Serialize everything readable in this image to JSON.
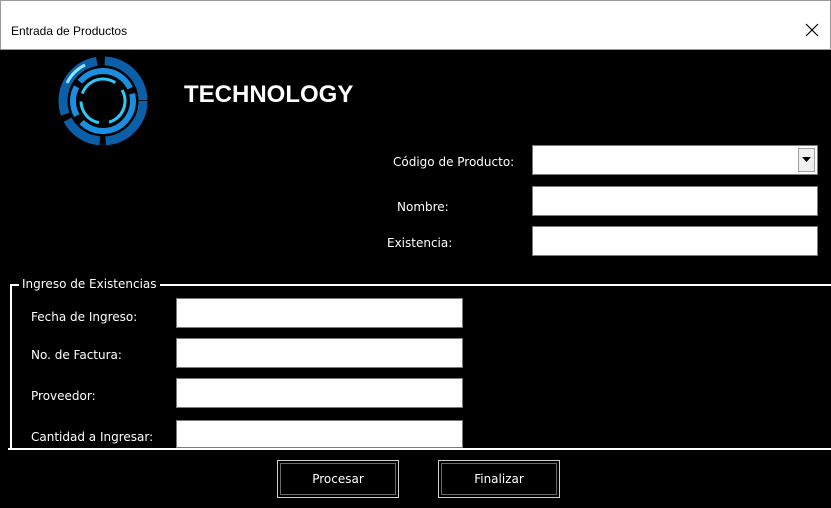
{
  "window": {
    "title": "Entrada de Productos",
    "close_glyph": "✕"
  },
  "brand": {
    "name": "TECHNOLOGY",
    "logo_icon": "circular-tech-logo-icon",
    "logo_colors": [
      "#0b5fa8",
      "#1c8ee0",
      "#31c6f5"
    ]
  },
  "product": {
    "codigo_label": "Código de Producto:",
    "codigo_value": "",
    "nombre_label": "Nombre:",
    "nombre_value": "",
    "existencia_label": "Existencia:",
    "existencia_value": ""
  },
  "ingreso": {
    "caption": "Ingreso de Existencias",
    "fecha_label": "Fecha de Ingreso:",
    "fecha_value": "",
    "factura_label": "No. de Factura:",
    "factura_value": "",
    "proveedor_label": "Proveedor:",
    "proveedor_value": "",
    "cantidad_label": "Cantidad a Ingresar:",
    "cantidad_value": ""
  },
  "buttons": {
    "procesar": "Procesar",
    "finalizar": "Finalizar"
  }
}
